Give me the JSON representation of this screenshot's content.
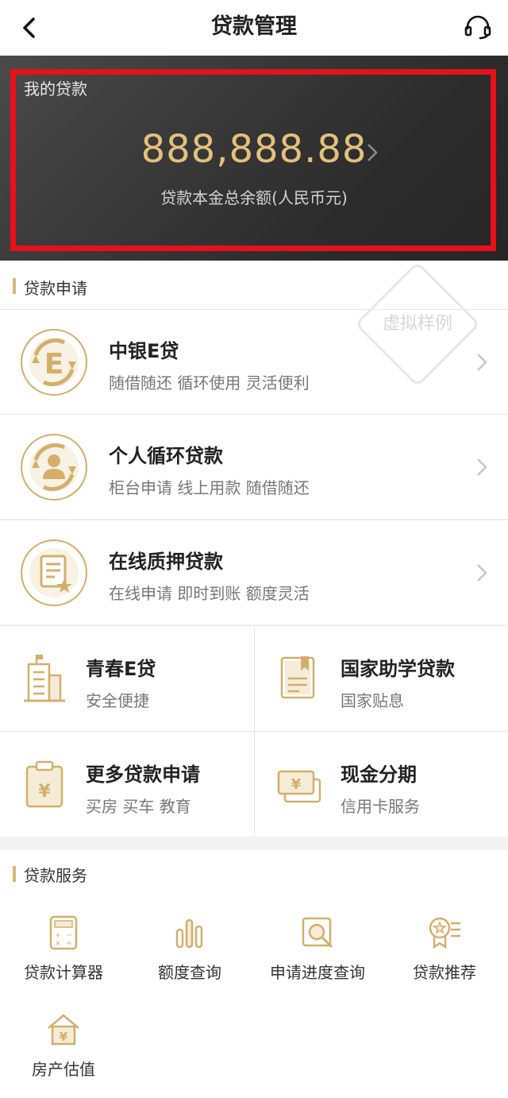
{
  "nav": {
    "title": "贷款管理",
    "back_icon": "chevron-left-icon",
    "service_icon": "headset-icon"
  },
  "hero": {
    "label": "我的贷款",
    "amount": "888,888.88",
    "subtitle": "贷款本金总余额(人民币元)",
    "amount_color": "#e3c17c",
    "highlight_color": "#e8101a"
  },
  "apply_section": {
    "title": "贷款申请",
    "watermark": "虚拟样例",
    "rows": [
      {
        "title": "中银E贷",
        "desc": "随借随还 循环使用 灵活便利",
        "icon": "e-loan-icon"
      },
      {
        "title": "个人循环贷款",
        "desc": "柜台申请 线上用款 随借随还",
        "icon": "person-cycle-icon"
      },
      {
        "title": "在线质押贷款",
        "desc": "在线申请 即时到账 额度灵活",
        "icon": "pledge-document-icon"
      }
    ],
    "grid": [
      {
        "title": "青春E贷",
        "desc": "安全便捷",
        "icon": "building-icon"
      },
      {
        "title": "国家助学贷款",
        "desc": "国家贴息",
        "icon": "book-icon"
      },
      {
        "title": "更多贷款申请",
        "desc": "买房 买车 教育",
        "icon": "clipboard-yuan-icon"
      },
      {
        "title": "现金分期",
        "desc": "信用卡服务",
        "icon": "cash-yuan-icon"
      }
    ]
  },
  "service_section": {
    "title": "贷款服务",
    "items": [
      {
        "label": "贷款计算器",
        "icon": "calculator-icon"
      },
      {
        "label": "额度查询",
        "icon": "bar-chart-icon"
      },
      {
        "label": "申请进度查询",
        "icon": "magnifier-icon"
      },
      {
        "label": "贷款推荐",
        "icon": "award-icon"
      },
      {
        "label": "房产估值",
        "icon": "house-yuan-icon"
      }
    ]
  },
  "colors": {
    "accent_gold": "#d8b877",
    "icon_gold": "#d4af6a"
  }
}
